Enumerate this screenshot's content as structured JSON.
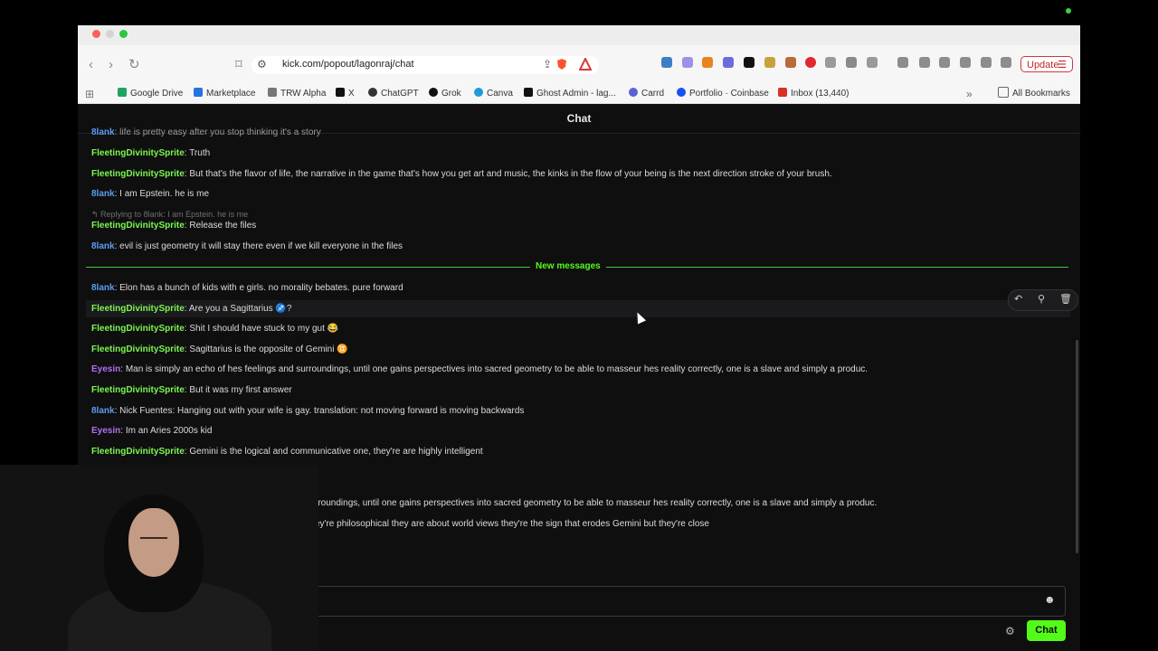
{
  "browser": {
    "url": "kick.com/popout/lagonraj/chat",
    "update_label": "Update",
    "bookmarks": [
      {
        "label": "Google Drive",
        "color": "#1fa463"
      },
      {
        "label": "Marketplace",
        "color": "#2374e1"
      },
      {
        "label": "TRW Alpha",
        "color": "#777777"
      },
      {
        "label": "X",
        "color": "#111111"
      },
      {
        "label": "ChatGPT",
        "color": "#333333"
      },
      {
        "label": "Grok",
        "color": "#111111"
      },
      {
        "label": "Canva",
        "color": "#1e9bd7"
      },
      {
        "label": "Ghost Admin - lag...",
        "color": "#111111"
      },
      {
        "label": "Carrd",
        "color": "#5b63d3"
      },
      {
        "label": "Portfolio · Coinbase",
        "color": "#1652f0"
      },
      {
        "label": "Inbox (13,440)",
        "color": "#d93025"
      }
    ],
    "all_bookmarks_label": "All Bookmarks"
  },
  "chat": {
    "header_title": "Chat",
    "partial_top_text": "life is pretty easy after you stop thinking it's a story",
    "messages_before": [
      {
        "user": "FleetingDivinitySprite",
        "text": "Truth",
        "color": "green"
      },
      {
        "user": "FleetingDivinitySprite",
        "text": "But that's the flavor of life, the narrative in the game that's how you get art and music, the kinks in the flow of your being is the next direction stroke of your brush.",
        "color": "green"
      },
      {
        "user": "8lank",
        "text": "I am Epstein. he is me",
        "color": "blue"
      }
    ],
    "reply_note": "Replying to 8lank: I am Epstein. he is me",
    "messages_after_reply": [
      {
        "user": "FleetingDivinitySprite",
        "text": "Release the files",
        "color": "green"
      },
      {
        "user": "8lank",
        "text": "evil is just geometry it will stay there even if we kill everyone in the files",
        "color": "blue"
      }
    ],
    "new_messages_label": "New messages",
    "new_messages": [
      {
        "user": "8lank",
        "text": "Elon has a bunch of kids with e girls. no morality bebates. pure forward",
        "color": "blue"
      },
      {
        "user": "FleetingDivinitySprite",
        "text": "Are you a Sagittarius ♐?",
        "color": "green"
      },
      {
        "user": "FleetingDivinitySprite",
        "text": "Shit I should have stuck to my gut 😂",
        "color": "green"
      },
      {
        "user": "FleetingDivinitySprite",
        "text": "Sagittarius is the opposite of Gemini ♊",
        "color": "green"
      },
      {
        "user": "Eyesin",
        "text": "Man is simply an echo of hes feelings and surroundings, until one gains perspectives into sacred geometry to be able to masseur hes reality correctly, one is a slave and simply a produc.",
        "color": "purple"
      },
      {
        "user": "FleetingDivinitySprite",
        "text": "But it was my first answer",
        "color": "green"
      },
      {
        "user": "8lank",
        "text": "Nick Fuentes: Hanging out with your wife is gay. translation: not moving forward is moving backwards",
        "color": "blue"
      },
      {
        "user": "Eyesin",
        "text": "Im an Aries 2000s kid",
        "color": "purple"
      },
      {
        "user": "FleetingDivinitySprite",
        "text": "Gemini is the logical and communicative one, they're are highly intelligent",
        "color": "green"
      }
    ],
    "obscured_lines": [
      "rroundings, until one gains perspectives into sacred geometry to be able to masseur hes reality correctly, one is a slave and simply a produc.",
      "ey're philosophical they are about world views they're the sign that erodes Gemini but they're close"
    ],
    "send_label": "Chat"
  },
  "colors": {
    "accent": "#53fc18",
    "user_blue": "#5b9cf0",
    "user_green": "#7cf550",
    "user_purple": "#b36ff0"
  }
}
